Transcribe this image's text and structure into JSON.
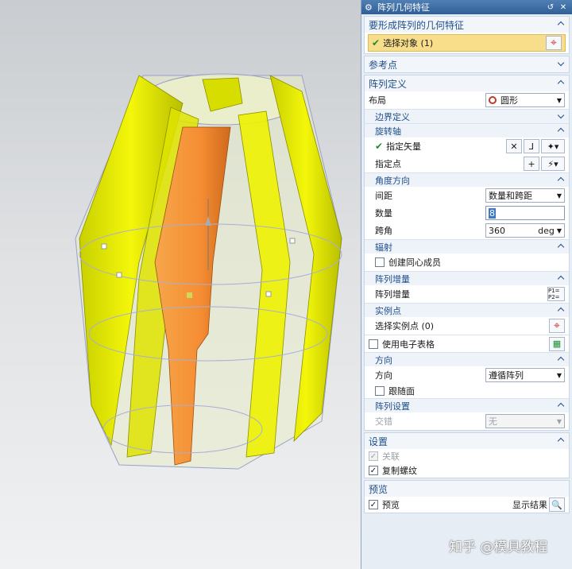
{
  "window": {
    "title": "阵列几何特征",
    "icons": {
      "gear": "gear-icon",
      "reset": "reset-icon",
      "close": "close-icon"
    }
  },
  "sections": {
    "geometry": {
      "title": "要形成阵列的几何特征",
      "select_label": "选择对象 (1)"
    },
    "reference": {
      "title": "参考点"
    },
    "pattern_def": {
      "title": "阵列定义",
      "layout_label": "布局",
      "layout_value": "圆形",
      "boundary": "边界定义",
      "rotation_axis": {
        "title": "旋转轴",
        "vector_label": "指定矢量",
        "point_label": "指定点"
      },
      "angle_dir": {
        "title": "角度方向",
        "spacing_label": "间距",
        "spacing_value": "数量和跨距",
        "count_label": "数量",
        "count_value": "8",
        "span_label": "跨角",
        "span_value": "360",
        "span_unit": "deg"
      },
      "radial": {
        "title": "辐射",
        "concentric_label": "创建同心成员"
      },
      "increment": {
        "title": "阵列增量",
        "label": "阵列增量",
        "btn": "P1= P2="
      },
      "instance": {
        "title": "实例点",
        "label": "选择实例点 (0)"
      },
      "spreadsheet_label": "使用电子表格",
      "orientation": {
        "title": "方向",
        "label": "方向",
        "value": "遵循阵列",
        "follow_face": "跟随面"
      },
      "settings": {
        "title": "阵列设置",
        "stagger_label": "交错",
        "stagger_value": "无"
      }
    },
    "settings": {
      "title": "设置",
      "associative": "关联",
      "copy_threads": "复制螺纹"
    },
    "preview": {
      "title": "预览",
      "preview_label": "预览",
      "show_result": "显示结果"
    }
  },
  "watermark": "知乎 @模具教程",
  "colors": {
    "accent": "#1e4e8c",
    "selection": "#f8dd8a",
    "yellow": "#e6ea00",
    "orange": "#f59a3c"
  }
}
